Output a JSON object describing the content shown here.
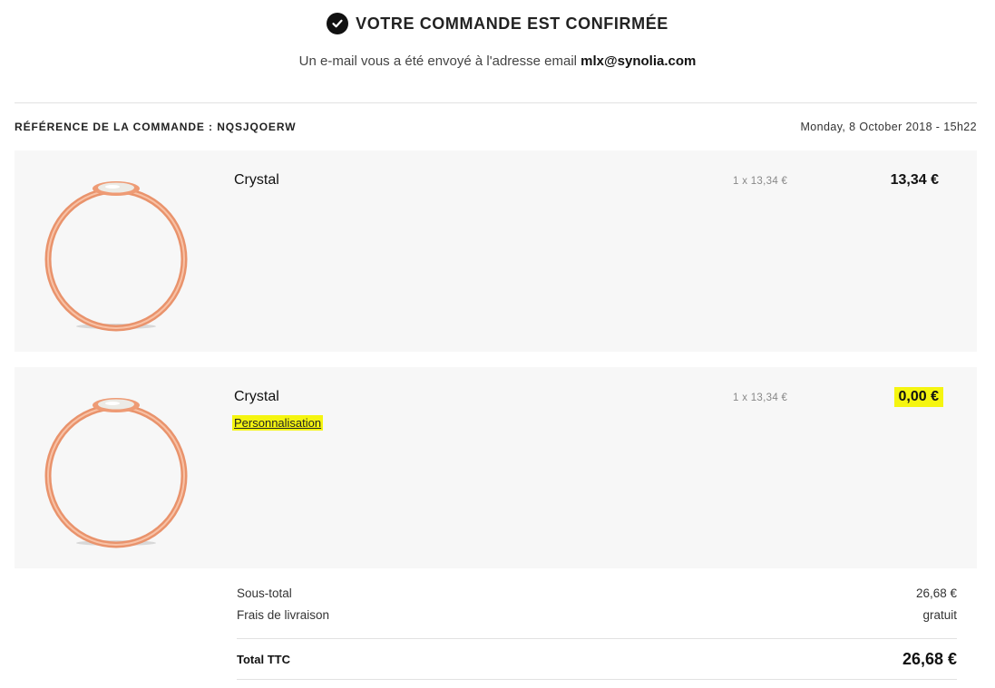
{
  "header": {
    "title": "VOTRE COMMANDE EST CONFIRMÉE",
    "subtitle_prefix": "Un e-mail vous a été envoyé à l'adresse email",
    "email": "mlx@synolia.com"
  },
  "order": {
    "reference": "RÉFÉRENCE DE LA COMMANDE : NQSJQOERW",
    "date": "Monday, 8 October 2018 - 15h22"
  },
  "products": [
    {
      "name": "Crystal",
      "quantity_text": "1 x 13,34 €",
      "price": "13,34 €",
      "image_icon": "ring-image"
    },
    {
      "name": "Crystal",
      "quantity_text": "1 x 13,34 €",
      "price": "0,00 €",
      "link": "Personnalisation",
      "image_icon": "ring-image"
    }
  ],
  "totals": {
    "subtotal_label": "Sous-total",
    "subtotal_value": "26,68 €",
    "shipping_label": "Frais de livraison",
    "shipping_value": "gratuit",
    "total_label": "Total TTC",
    "total_value": "26,68 €"
  },
  "colors": {
    "highlight": "#f5f510",
    "ring": "#f0a480",
    "panel_bg": "#f7f7f7"
  }
}
